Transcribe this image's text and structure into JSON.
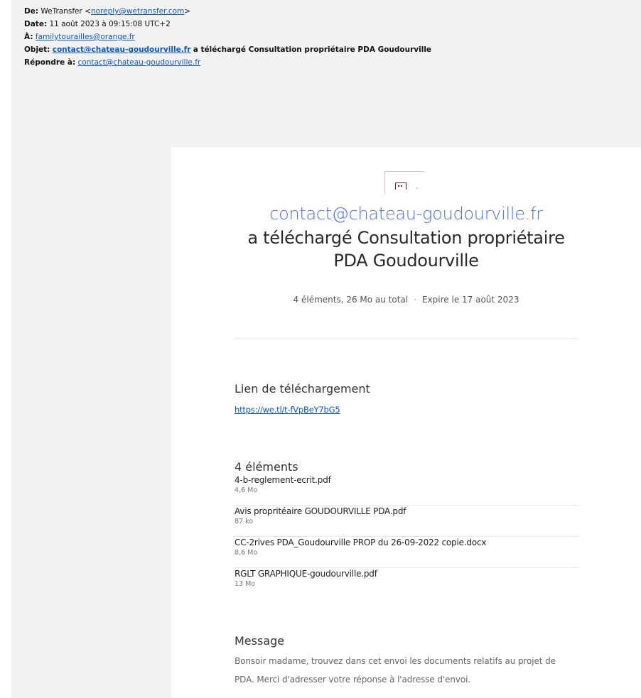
{
  "headers": {
    "from_label": "De:",
    "from_name": "WeTransfer <",
    "from_email": "noreply@wetransfer.com",
    "from_close": ">",
    "date_label": "Date:",
    "date_value": "11 août 2023 à 09:15:08 UTC+2",
    "to_label": "À:",
    "to_email": "familytourailles@orange.fr",
    "subject_label": "Objet:",
    "subject_email": "contact@chateau-goudourville.fr",
    "subject_text": "a téléchargé Consultation propriétaire PDA Goudourville",
    "reply_label": "Répondre à:",
    "reply_email": "contact@chateau-goudourville.fr"
  },
  "card": {
    "sender": "contact@chateau-goudourville.fr",
    "action_line1": "a téléchargé Consultation propriétaire",
    "action_line2": "PDA Goudourville",
    "meta_count": "4 éléments, 26 Mo au total",
    "meta_sep": "·",
    "meta_expiry": "Expire le 17 août 2023",
    "download_title": "Lien de téléchargement",
    "download_link": "https://we.tl/t-fVpBeY7bG5",
    "items_title": "4 éléments",
    "files": [
      {
        "name": "4-b-reglement-ecrit.pdf",
        "size": "4,6 Mo"
      },
      {
        "name": "Avis propritéaire GOUDOURVILLE PDA.pdf",
        "size": "87 ko"
      },
      {
        "name": "CC-2rives PDA_Goudourville PROP du 26-09-2022 copie.docx",
        "size": "8,6 Mo"
      },
      {
        "name": "RGLT GRAPHIQUE-goudourville.pdf",
        "size": "13 Mo"
      }
    ],
    "message_title": "Message",
    "message_body": "Bonsoir madame, trouvez dans cet envoi les documents relatifs au projet de PDA. Merci d'adresser votre réponse à l'adresse d'envoi."
  },
  "colors": {
    "link": "#0b57d0",
    "sender_accent": "#4d6ef2",
    "mail_background": "#f2f2f2"
  }
}
